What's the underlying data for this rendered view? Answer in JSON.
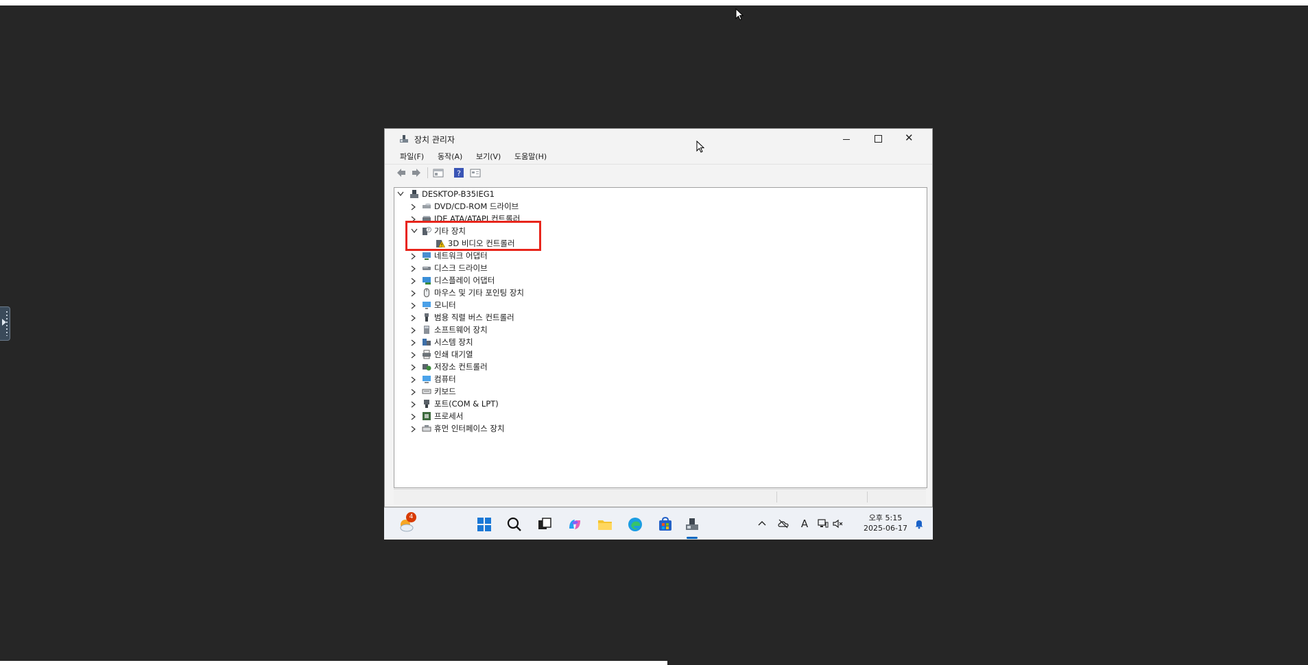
{
  "window": {
    "title": "장치 관리자",
    "menu": [
      "파일(F)",
      "동작(A)",
      "보기(V)",
      "도움말(H)"
    ]
  },
  "tree": {
    "root": "DESKTOP-B35IEG1",
    "items": [
      {
        "label": "DVD/CD-ROM 드라이브",
        "icon": "dvd-drive-icon",
        "state": "collapsed"
      },
      {
        "label": "IDE ATA/ATAPI 컨트롤러",
        "icon": "ide-controller-icon",
        "state": "collapsed"
      },
      {
        "label": "기타 장치",
        "icon": "other-devices-icon",
        "state": "expanded"
      },
      {
        "label": "3D 비디오 컨트롤러",
        "icon": "warning-device-icon",
        "state": "child"
      },
      {
        "label": "네트워크 어댑터",
        "icon": "network-adapter-icon",
        "state": "collapsed"
      },
      {
        "label": "디스크 드라이브",
        "icon": "disk-drive-icon",
        "state": "collapsed"
      },
      {
        "label": "디스플레이 어댑터",
        "icon": "display-adapter-icon",
        "state": "collapsed"
      },
      {
        "label": "마우스 및 기타 포인팅 장치",
        "icon": "mouse-icon",
        "state": "collapsed"
      },
      {
        "label": "모니터",
        "icon": "monitor-icon",
        "state": "collapsed"
      },
      {
        "label": "범용 직렬 버스 컨트롤러",
        "icon": "usb-icon",
        "state": "collapsed"
      },
      {
        "label": "소프트웨어 장치",
        "icon": "software-device-icon",
        "state": "collapsed"
      },
      {
        "label": "시스템 장치",
        "icon": "system-device-icon",
        "state": "collapsed"
      },
      {
        "label": "인쇄 대기열",
        "icon": "printer-icon",
        "state": "collapsed"
      },
      {
        "label": "저장소 컨트롤러",
        "icon": "storage-controller-icon",
        "state": "collapsed"
      },
      {
        "label": "컴퓨터",
        "icon": "computer-icon",
        "state": "collapsed"
      },
      {
        "label": "키보드",
        "icon": "keyboard-icon",
        "state": "collapsed"
      },
      {
        "label": "포트(COM & LPT)",
        "icon": "port-icon",
        "state": "collapsed"
      },
      {
        "label": "프로세서",
        "icon": "processor-icon",
        "state": "collapsed"
      },
      {
        "label": "휴먼 인터페이스 장치",
        "icon": "hid-icon",
        "state": "collapsed"
      }
    ]
  },
  "taskbar": {
    "weather_badge": "4",
    "clock_time": "오후 5:15",
    "clock_date": "2025-06-17",
    "ime_label": "A"
  },
  "colors": {
    "highlight": "#e8251b",
    "accent": "#0067c0",
    "background": "#262626"
  }
}
